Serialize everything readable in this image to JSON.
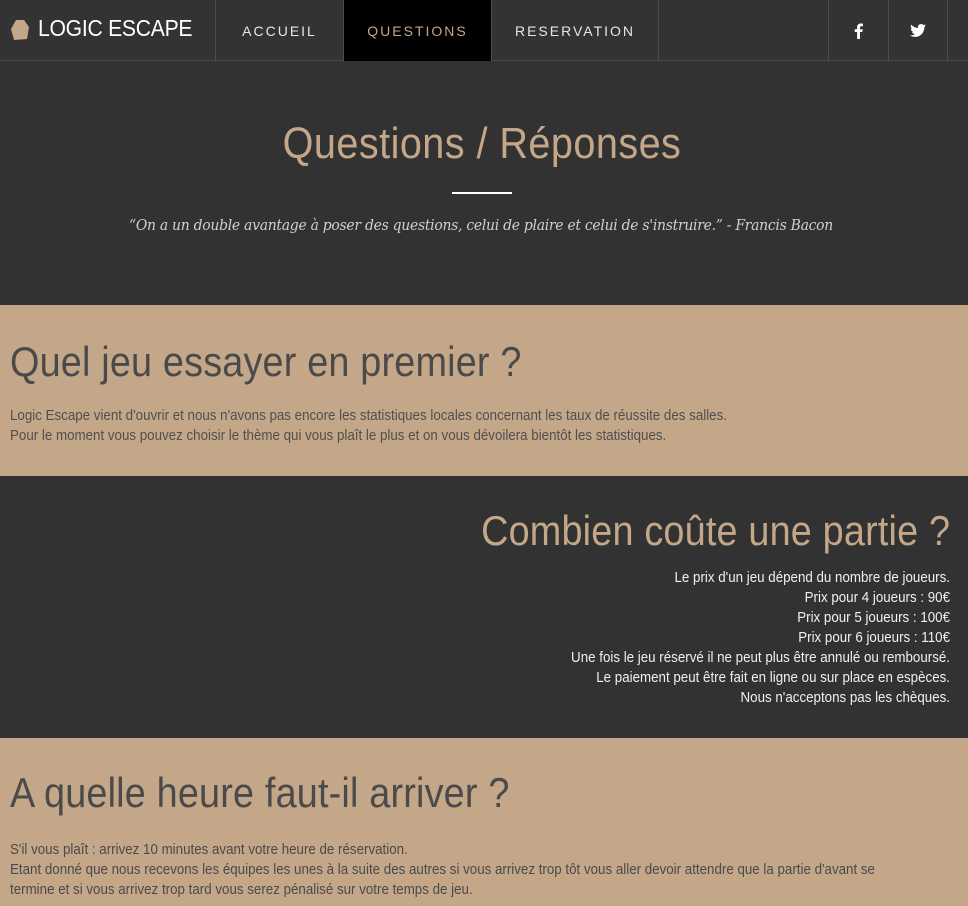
{
  "nav": {
    "brand": "LOGIC ESCAPE",
    "links": [
      {
        "label": "ACCUEIL"
      },
      {
        "label": "QUESTIONS",
        "active": true
      },
      {
        "label": "RESERVATION"
      }
    ],
    "social": [
      "facebook-icon",
      "twitter-icon"
    ]
  },
  "hero": {
    "title": "Questions / Réponses",
    "quote": "“On a un double avantage à poser des questions, celui de plaire et celui de s'instruire.”  - Francis Bacon"
  },
  "faq": [
    {
      "title": "Quel jeu essayer en premier ?",
      "lines": [
        "Logic Escape vient d'ouvrir et nous n'avons pas encore les statistiques locales concernant les taux de réussite des salles.",
        "Pour le moment vous pouvez choisir le thème qui vous plaît le plus et on vous dévoilera bientôt les statistiques."
      ]
    },
    {
      "title": "Combien coûte une partie ?",
      "lines": [
        "Le prix d'un jeu dépend du nombre de joueurs.",
        "Prix pour 4 joueurs : 90€",
        "Prix pour 5 joueurs : 100€",
        "Prix pour 6 joueurs : 110€",
        "Une fois le jeu réservé il ne peut plus être annulé ou remboursé.",
        "Le paiement peut être fait en ligne ou sur place en espèces.",
        "Nous n'acceptons pas les chèques."
      ]
    },
    {
      "title": "A quelle heure faut-il arriver ?",
      "lines": [
        "S'il vous plaît : arrivez 10 minutes avant votre heure de réservation.",
        "Etant donné que nous recevons les équipes les unes à la suite des autres si vous arrivez trop tôt vous aller devoir attendre que la partie d'avant se",
        "termine et si vous arrivez trop tard vous serez pénalisé sur votre temps de jeu."
      ]
    }
  ],
  "colors": {
    "accent": "#c4a789",
    "dark": "#323232",
    "active_nav": "#000000"
  }
}
